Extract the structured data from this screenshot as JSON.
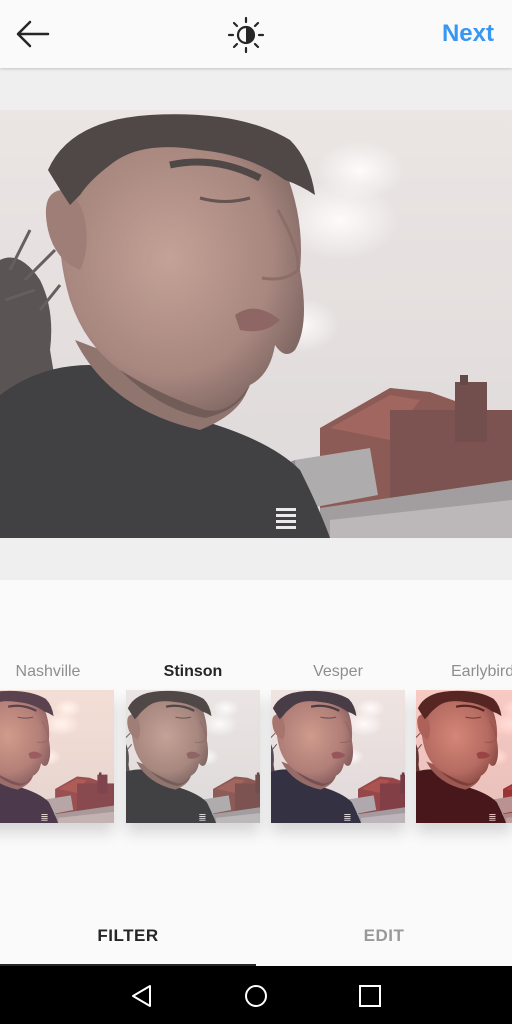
{
  "header": {
    "back_icon": "arrow-left-icon",
    "lux_icon": "lux-brightness-icon",
    "next_label": "Next",
    "accent_color": "#3897f0"
  },
  "filters": [
    {
      "label": "Nashville",
      "selected": false
    },
    {
      "label": "Stinson",
      "selected": true
    },
    {
      "label": "Vesper",
      "selected": false
    },
    {
      "label": "Earlybird",
      "selected": false
    }
  ],
  "tabs": {
    "filter_label": "FILTER",
    "edit_label": "EDIT",
    "active": "FILTER"
  },
  "navbar": {
    "back_icon": "triangle-back-icon",
    "home_icon": "circle-home-icon",
    "recents_icon": "square-recents-icon"
  }
}
